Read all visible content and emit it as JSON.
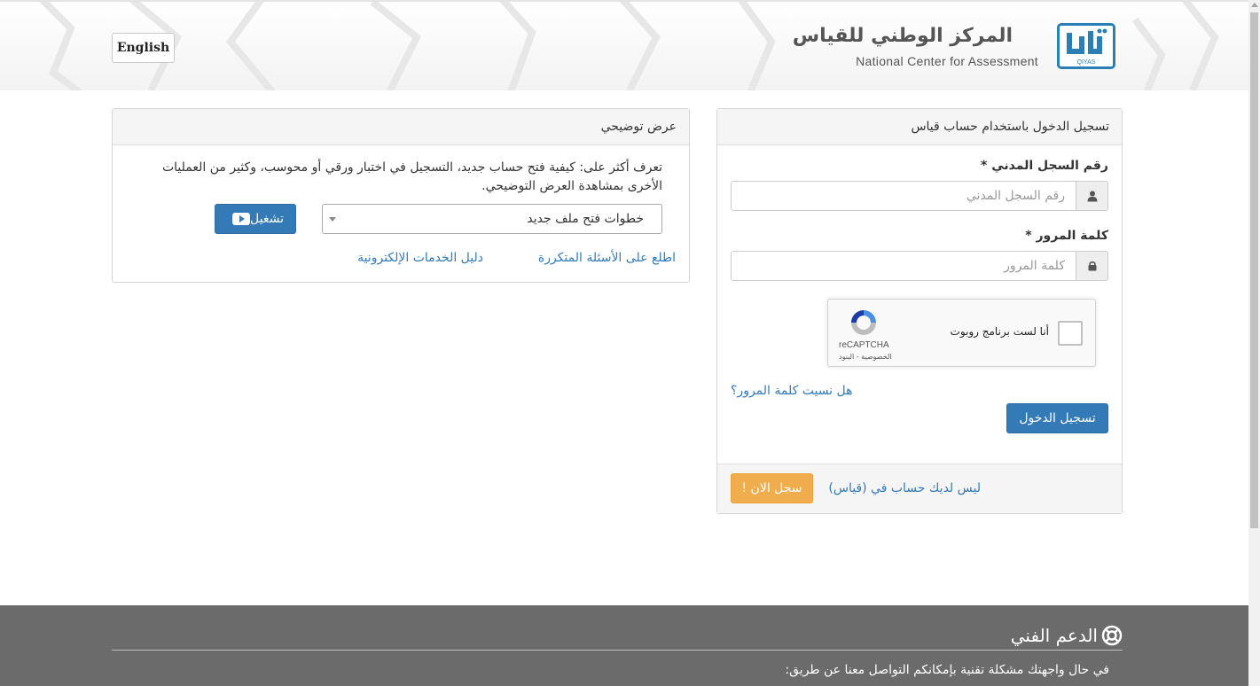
{
  "header": {
    "language_button": "English",
    "logo": {
      "arabic_name": "المركز الوطني للقياس",
      "english_name": "National Center for Assessment",
      "mark_text": "QIYAS"
    }
  },
  "login_panel": {
    "heading": "تسجيل الدخول باستخدام حساب قياس",
    "id_label": "رقم السجل المدني *",
    "id_placeholder": "رقم السجل المدني",
    "password_label": "كلمة المرور *",
    "password_placeholder": "كلمة المرور",
    "recaptcha": {
      "checkbox_label": "أنا لست برنامج روبوت",
      "brand": "reCAPTCHA",
      "terms": "الخصوصية - البنود"
    },
    "forgot_password": "هل نسيت كلمة المرور؟",
    "login_button": "تسجيل الدخول",
    "no_account_text": "ليس لديك حساب في (قياس)",
    "register_button": "سجل الان !"
  },
  "demo_panel": {
    "heading": "عرض توضيحي",
    "description": "تعرف أكثر على: كيفية فتح حساب جديد، التسجيل في اختبار ورقي أو محوسب، وكثير من العمليات الأخرى بمشاهدة العرض التوضيحي.",
    "select_value": "خطوات فتح ملف جديد",
    "play_button": "تشغيل",
    "faq_link": "اطلع على الأسئلة المتكررة",
    "guide_link": "دليل الخدمات الإلكترونية"
  },
  "footer": {
    "support_title": "الدعم الفني",
    "support_text": "في حال واجهتك مشكلة تقنية بإمكانكم التواصل معنا عن طريق:"
  },
  "colors": {
    "primary": "#337ab7",
    "warning": "#f0ad4e",
    "footer_bg": "#6b6b6b",
    "logo_blue": "#2b7fb5"
  },
  "icons": {
    "user": "user-icon",
    "lock": "lock-icon",
    "play": "youtube-play-icon",
    "support": "life-ring-icon",
    "recaptcha": "recaptcha-logo-icon"
  }
}
